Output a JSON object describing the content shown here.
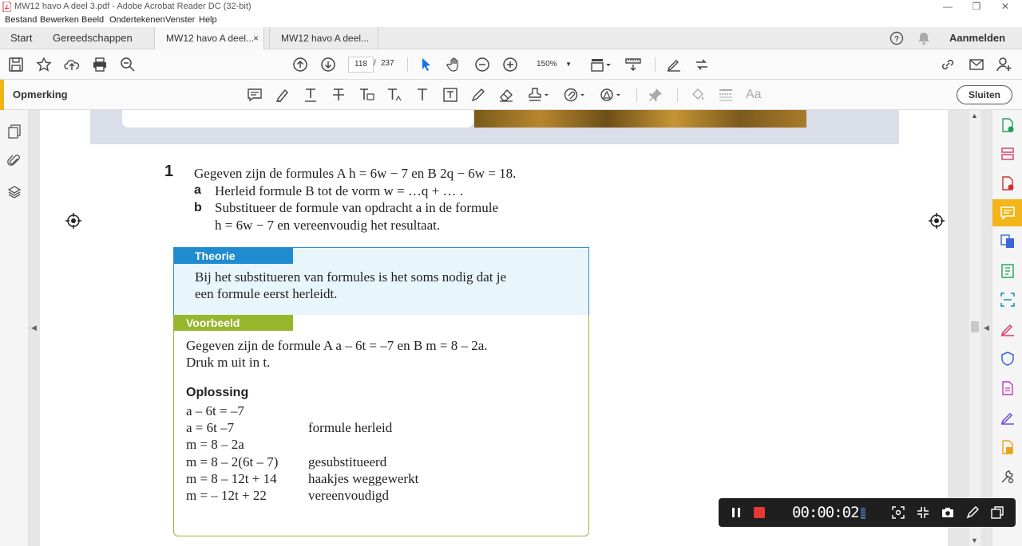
{
  "window": {
    "title": "MW12 havo A deel 3.pdf - Adobe Acrobat Reader DC (32-bit)"
  },
  "menu": [
    "Bestand",
    "Bewerken",
    "Beeld",
    "Ondertekenen",
    "Venster",
    "Help"
  ],
  "tabs": {
    "start": "Start",
    "tools": "Gereedschappen",
    "doc1": "MW12 havo A deel...",
    "doc2": "MW12 havo A deel...",
    "close": "×",
    "signin": "Aanmelden"
  },
  "toolbar": {
    "page": "118",
    "separator": "/",
    "total": "237",
    "zoom": "150%"
  },
  "comment": {
    "label": "Opmerking",
    "close": "Sluiten"
  },
  "document": {
    "question_number": "1",
    "question_intro": "Gegeven zijn de formules A h = 6w − 7 en B 2q − 6w = 18.",
    "a_letter": "a",
    "a_text": "Herleid formule B tot de vorm w = …q + … .",
    "b_letter": "b",
    "b_text1": "Substitueer de formule van opdracht a in de formule",
    "b_text2": "h = 6w − 7 en vereenvoudig het resultaat.",
    "theorie_title": "Theorie",
    "theorie_line1": "Bij het substitueren van formules is het soms nodig dat je",
    "theorie_line2": "een formule eerst herleidt.",
    "voorbeeld_title": "Voorbeeld",
    "voorbeeld_line1": "Gegeven zijn de formule A a – 6t = –7 en B m = 8 – 2a.",
    "voorbeeld_line2": "Druk m uit in t.",
    "oplossing_title": "Oplossing",
    "steps": [
      {
        "formula": "a – 6t = –7",
        "note": ""
      },
      {
        "formula": "a = 6t –7",
        "note": "formule herleid"
      },
      {
        "formula": "m = 8 – 2a",
        "note": ""
      },
      {
        "formula": "m = 8 – 2(6t – 7)",
        "note": "gesubstitueerd"
      },
      {
        "formula": "m = 8 – 12t + 14",
        "note": "haakjes weggewerkt"
      },
      {
        "formula": "m =  – 12t + 22",
        "note": "vereenvoudigd"
      }
    ]
  },
  "recorder": {
    "timer": "00:00:02"
  },
  "colors": {
    "accent": "#f0b416",
    "theorie": "#1f8bd1",
    "voorbeeld": "#97b62c",
    "record": "#e53935"
  }
}
